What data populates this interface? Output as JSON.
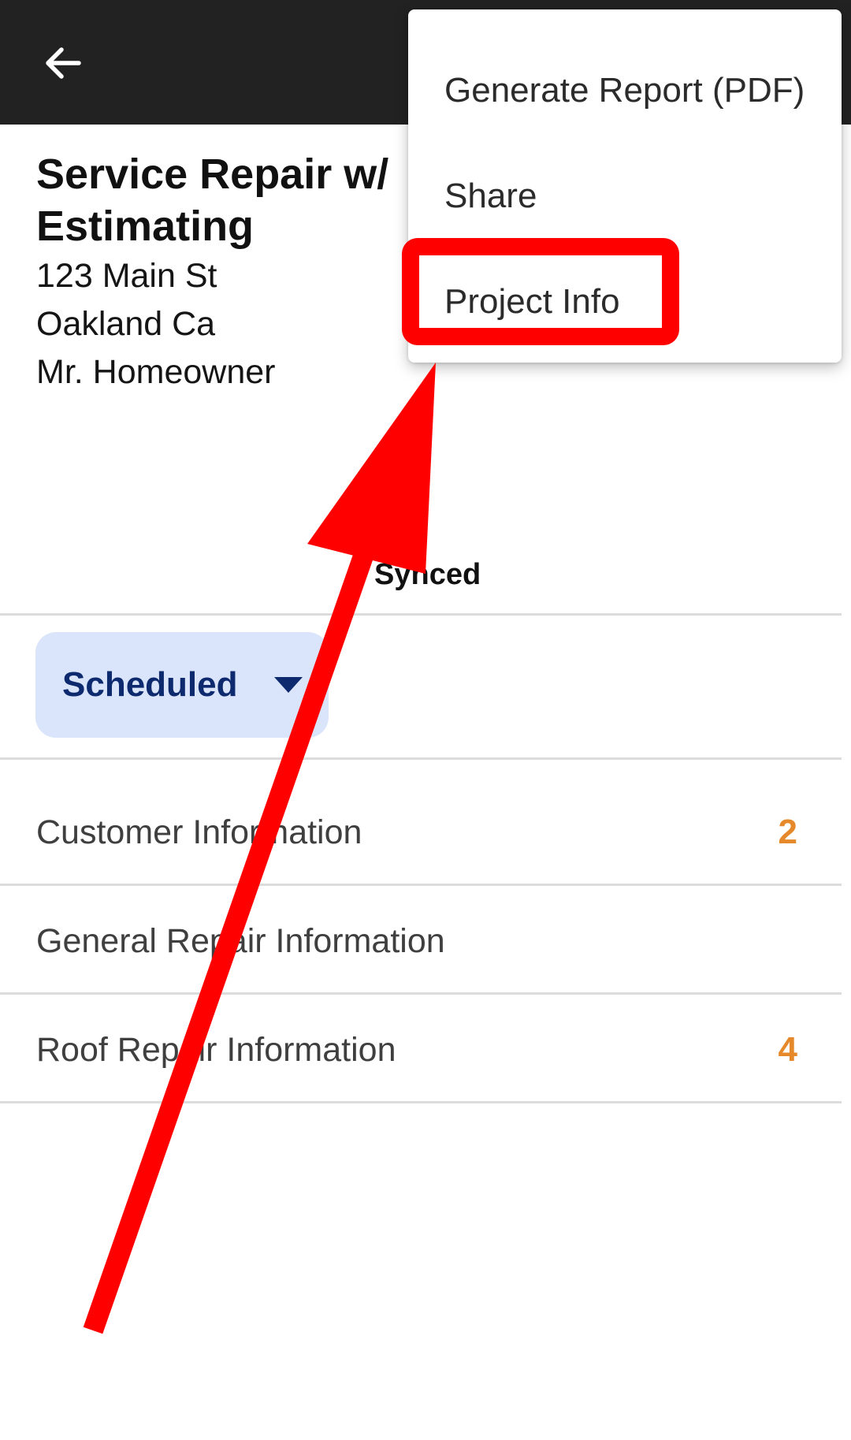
{
  "appbar": {
    "back_icon": "arrow-left-icon"
  },
  "project": {
    "title": "Service Repair w/ Estimating",
    "address_line1": "123 Main St",
    "address_line2": "Oakland Ca",
    "owner": "Mr. Homeowner"
  },
  "sync_status": "Synced",
  "status_dropdown": {
    "value": "Scheduled",
    "icon": "caret-down-icon"
  },
  "sections": [
    {
      "label": "Customer Information",
      "count": "2"
    },
    {
      "label": "General Repair Information",
      "count": ""
    },
    {
      "label": "Roof Repair Information",
      "count": "4"
    }
  ],
  "menu": {
    "items": [
      {
        "label": "Generate Report (PDF)"
      },
      {
        "label": "Share"
      },
      {
        "label": "Project Info"
      }
    ]
  },
  "annotation": {
    "color": "#ff0000"
  },
  "colors": {
    "appbar": "#222222",
    "chip_bg": "#dae5fb",
    "chip_text": "#0e2a6e",
    "count": "#e5892a"
  }
}
